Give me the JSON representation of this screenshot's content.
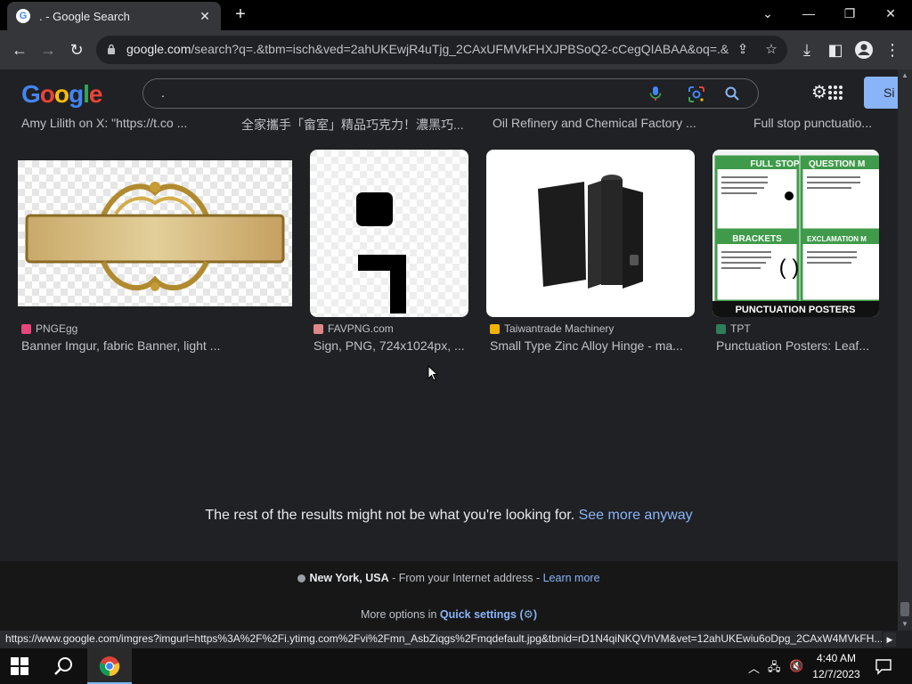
{
  "browser": {
    "tab_title": ". - Google Search",
    "favicon_letter": "G",
    "new_tab": "+",
    "url_host": "google.com",
    "url_rest": "/search?q=.&tbm=isch&ved=2ahUKEwjR4uTjg_2CAxUFMVkFHXJPBSoQ2-cCegQIABAA&oq=.&...",
    "status_url": "https://www.google.com/imgres?imgurl=https%3A%2F%2Fi.ytimg.com%2Fvi%2Fmn_AsbZiqgs%2Fmqdefault.jpg&tbnid=rD1N4qiNKQVhVM&vet=12ahUKEwiu6oDpg_2CAxW4MVkFH..."
  },
  "google": {
    "logo_letters": [
      "G",
      "o",
      "o",
      "g",
      "l",
      "e"
    ],
    "logo_colors": [
      "#4285f4",
      "#ea4335",
      "#fbbc05",
      "#4285f4",
      "#34a853",
      "#ea4335"
    ],
    "query": ".",
    "signin": "Si"
  },
  "prev_row_captions": [
    "Amy Lilith on X: \"https://t.co ...",
    "全家攜手「畲室」精品巧克力！濃黑巧...",
    "Oil Refinery and Chemical Factory ...",
    "Full stop punctuatio..."
  ],
  "results": [
    {
      "source": "PNGEgg",
      "title": "Banner Imgur, fabric Banner, light ...",
      "fav_color": "#e8457c"
    },
    {
      "source": "FAVPNG.com",
      "title": "Sign, PNG, 724x1024px, ...",
      "fav_color": "#d88"
    },
    {
      "source": "Taiwantrade Machinery",
      "title": "Small Type Zinc Alloy Hinge - ma...",
      "fav_color": "#f2b400"
    },
    {
      "source": "TPT",
      "title": "Punctuation Posters: Leaf...",
      "fav_color": "#2e7d5b"
    }
  ],
  "poster": {
    "full_stop": "FULL STOP",
    "question": "QUESTION M",
    "brackets": "BRACKETS",
    "exclamation": "EXCLAMATION M",
    "banner": "PUNCTUATION POSTERS"
  },
  "more": {
    "message": "The rest of the results might not be what you're looking for.",
    "link": "See more anyway"
  },
  "footer": {
    "location": "New York, USA",
    "location_suffix": " - From your Internet address - ",
    "learn_more": "Learn more",
    "more_options": "More options in ",
    "quick_settings": "Quick settings"
  },
  "taskbar": {
    "time": "4:40 AM",
    "date": "12/7/2023"
  }
}
